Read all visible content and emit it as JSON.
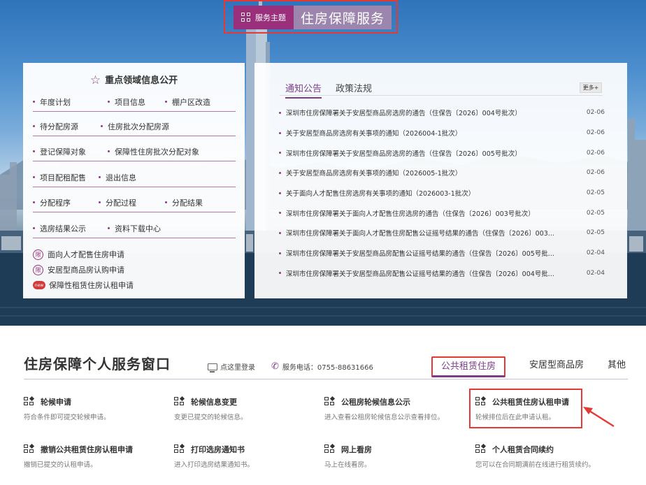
{
  "theme": {
    "tag": "服务主题",
    "title": "住房保障服务",
    "grid_icon": "grid-icon"
  },
  "left_panel": {
    "title": "重点领域信息公开",
    "star_icon": "star-icon",
    "rows": [
      [
        "年度计划",
        "项目信息",
        "棚户区改造"
      ],
      [
        "待分配房源",
        "住房批次分配房源"
      ],
      [
        "登记保障对象",
        "保障性住房批次分配对象"
      ],
      [
        "项目配租配售",
        "退出信息"
      ],
      [
        "分配程序",
        "分配过程",
        "分配结果"
      ],
      [
        "选房结果公示",
        "资料下载中心"
      ]
    ],
    "applications": [
      {
        "icon": "限",
        "label": "面向人才配售住房申请"
      },
      {
        "icon": "限",
        "label": "安居型商品房认购申请"
      },
      {
        "icon": "new",
        "label": "保障性租赁住房认租申请"
      }
    ]
  },
  "right_panel": {
    "tabs": [
      "通知公告",
      "政策法规"
    ],
    "more": "更多+",
    "news": [
      {
        "title": "深圳市住房保障署关于安居型商品房选房的通告（住保告〔2026〕004号批次）",
        "date": "02-06"
      },
      {
        "title": "关于安居型商品房选房有关事项的通知（2026004-1批次）",
        "date": "02-06"
      },
      {
        "title": "深圳市住房保障署关于安居型商品房选房的通告（住保告〔2026〕005号批次）",
        "date": "02-06"
      },
      {
        "title": "关于安居型商品房选房有关事项的通知（2026005-1批次）",
        "date": "02-06"
      },
      {
        "title": "关于面向人才配售住房选房有关事项的通知（2026003-1批次）",
        "date": "02-05"
      },
      {
        "title": "深圳市住房保障署关于面向人才配售住房选房的通告（住保告〔2026〕003号批次）",
        "date": "02-05"
      },
      {
        "title": "深圳市住房保障署关于面向人才配售住房配售公证摇号结果的通告（住保告〔2026〕003...",
        "date": "02-05"
      },
      {
        "title": "深圳市住房保障署关于安居型商品房配售公证摇号结果的通告（住保告〔2026〕005号批...",
        "date": "02-04"
      },
      {
        "title": "深圳市住房保障署关于安居型商品房配售公证摇号结果的通告（住保告〔2026〕004号批...",
        "date": "02-04"
      }
    ]
  },
  "service": {
    "title": "住房保障个人服务窗口",
    "login": "点这里登录",
    "phone": "服务电话：0755-88631666",
    "tabs": [
      "公共租赁住房",
      "安居型商品房",
      "其他"
    ],
    "cards": [
      {
        "title": "轮候申请",
        "desc": "符合条件即可提交轮候申请。"
      },
      {
        "title": "轮候信息变更",
        "desc": "变更已提交的轮候信息。"
      },
      {
        "title": "公租房轮候信息公示",
        "desc": "进入查看公租房轮候信息公示查看排位。"
      },
      {
        "title": "公共租赁住房认租申请",
        "desc": "轮候排位后在此申请认租。"
      },
      {
        "title": "撤销公共租赁住房认租申请",
        "desc": "撤销已提交的认租申请。"
      },
      {
        "title": "打印选房通知书",
        "desc": "进入打印选房结果通知书。"
      },
      {
        "title": "网上看房",
        "desc": "马上在线看房。"
      },
      {
        "title": "个人租赁合同续约",
        "desc": "您可以在合同期满前在线进行租赁续约。"
      }
    ]
  },
  "colors": {
    "brand": "#9a2f7b",
    "accent": "#7c3d87",
    "highlight": "#e53935"
  }
}
